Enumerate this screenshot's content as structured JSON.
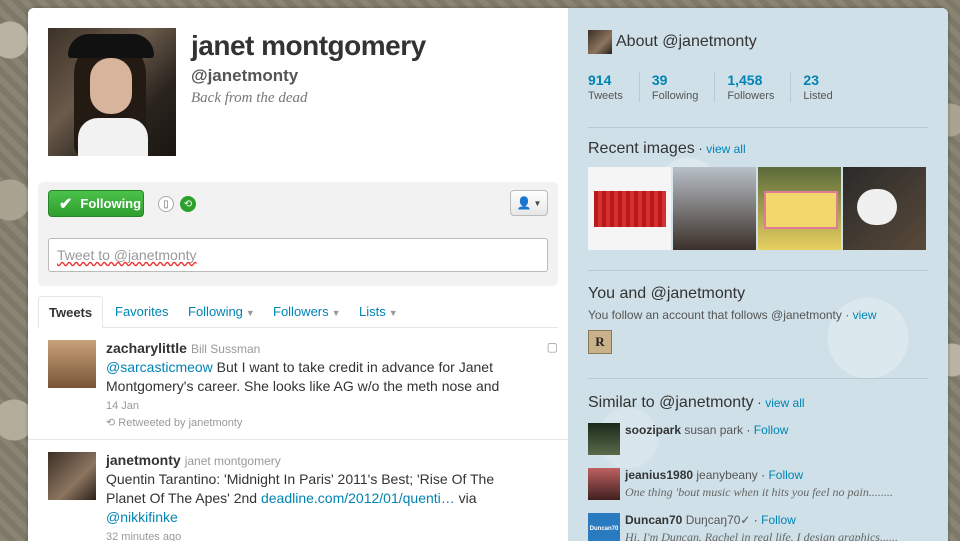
{
  "profile": {
    "name": "janet montgomery",
    "handle": "@janetmonty",
    "bio": "Back from the dead"
  },
  "actions": {
    "follow_label": "Following",
    "follow_icon": "checkmark-icon",
    "tweet_placeholder": "Tweet to @janetmonty",
    "device_icon": "phone-icon",
    "retweet_icon": "retweet-icon",
    "user_menu_icon": "person-icon"
  },
  "tabs": [
    {
      "label": "Tweets",
      "active": true
    },
    {
      "label": "Favorites"
    },
    {
      "label": "Following",
      "dropdown": true
    },
    {
      "label": "Followers",
      "dropdown": true
    },
    {
      "label": "Lists",
      "dropdown": true
    }
  ],
  "tweets": [
    {
      "author": "zacharylittle",
      "fullname": "Bill Sussman",
      "mention": "@sarcasticmeow",
      "text": " But I want to take credit in advance for Janet Montgomery's career. She looks like AG w/o the meth nose and",
      "time": "14 Jan",
      "retweeted_by": "Retweeted by janetmonty"
    },
    {
      "author": "janetmonty",
      "fullname": "janet montgomery",
      "text": "Quentin Tarantino: 'Midnight In Paris' 2011's Best; 'Rise Of The Planet Of The Apes' 2nd ",
      "link": "deadline.com/2012/01/quenti…",
      "text2": " via",
      "mention": "@nikkifinke",
      "time": "32 minutes ago"
    }
  ],
  "dashboard": {
    "about_title": "About @janetmonty",
    "stats": [
      {
        "num": "914",
        "label": "Tweets"
      },
      {
        "num": "39",
        "label": "Following"
      },
      {
        "num": "1,458",
        "label": "Followers"
      },
      {
        "num": "23",
        "label": "Listed"
      }
    ],
    "recent_images_title": "Recent images",
    "view_all": "view all",
    "you_title": "You and @janetmonty",
    "you_desc": "You follow an account that follows @janetmonty",
    "view": "view",
    "similar_title": "Similar to @janetmonty",
    "follow": "Follow",
    "similar": [
      {
        "name": "soozipark",
        "fullname": "susan park",
        "bio": ""
      },
      {
        "name": "jeanius1980",
        "fullname": "jeanybeany",
        "bio": "One thing 'bout music when it hits you feel no pain........"
      },
      {
        "name": "Duncan70",
        "fullname": "Duŋcaŋ70✓",
        "bio": "Hi, I'm Duŋcaŋ. Rachel in real life. I design graphics......",
        "avatar_text": "Duncan70"
      }
    ]
  }
}
